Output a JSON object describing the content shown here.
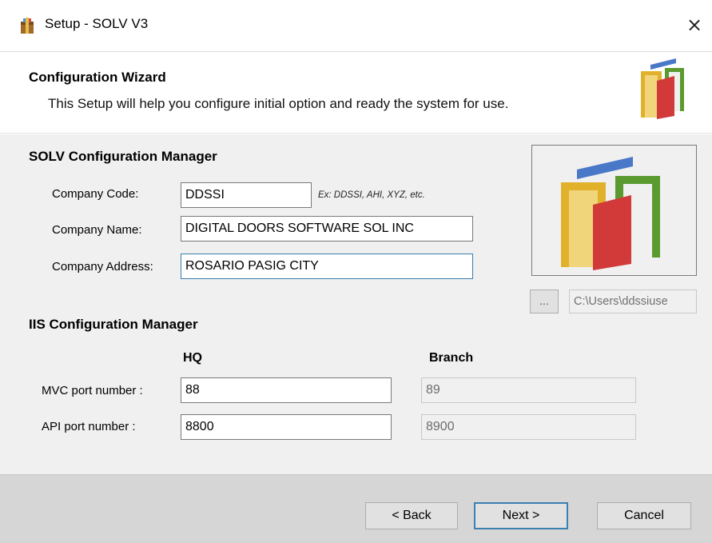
{
  "window": {
    "title": "Setup - SOLV V3",
    "close_glyph": "×",
    "app_icon": "installer-box-icon"
  },
  "header": {
    "title": "Configuration Wizard",
    "subtitle": "This Setup will help you configure initial option and ready the system for use.",
    "logo_icon": "solv-logo-icon"
  },
  "solv_config": {
    "title": "SOLV Configuration Manager",
    "company_code": {
      "label": "Company Code:",
      "value": "DDSSI",
      "hint": "Ex: DDSSI, AHI, XYZ, etc."
    },
    "company_name": {
      "label": "Company Name:",
      "value": "DIGITAL DOORS SOFTWARE SOL INC"
    },
    "company_address": {
      "label": "Company Address:",
      "value": "ROSARIO PASIG CITY"
    },
    "logo_browse_label": "...",
    "logo_path": "C:\\Users\\ddssiuse"
  },
  "iis_config": {
    "title": "IIS Configuration Manager",
    "col_hq": "HQ",
    "col_branch": "Branch",
    "mvc_port": {
      "label": "MVC port number :",
      "hq": "88",
      "branch": "89"
    },
    "api_port": {
      "label": "API port number :",
      "hq": "8800",
      "branch": "8900"
    }
  },
  "footer": {
    "back_label": "< Back",
    "next_label": "Next >",
    "cancel_label": "Cancel"
  },
  "colors": {
    "logo_yellow": "#e2b12b",
    "logo_green": "#5a9a2e",
    "logo_red": "#d23a3a",
    "logo_blue": "#4a78c8",
    "focus_border": "#3c7fb1"
  }
}
